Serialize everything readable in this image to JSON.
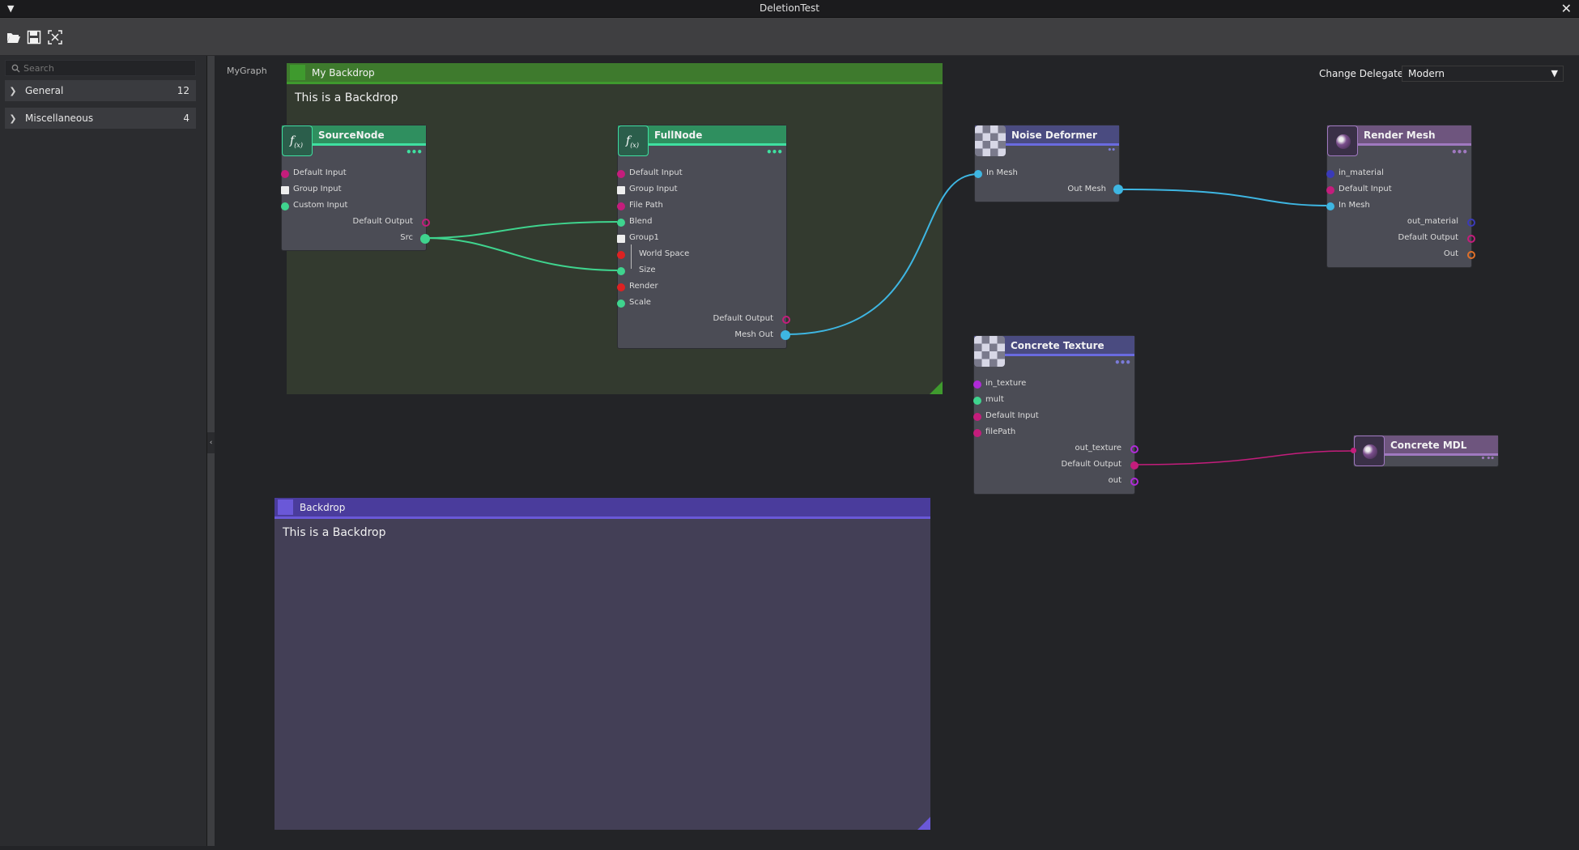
{
  "window": {
    "title": "DeletionTest"
  },
  "sidebar": {
    "search_placeholder": "Search",
    "categories": [
      {
        "label": "General",
        "count": "12"
      },
      {
        "label": "Miscellaneous",
        "count": "4"
      }
    ]
  },
  "canvas": {
    "graph_name": "MyGraph",
    "delegate_label": "Change Delegate",
    "delegate_value": "Modern"
  },
  "backdrops": {
    "green": {
      "title": "My Backdrop",
      "text": "This is a Backdrop",
      "color": "#3f9a2e"
    },
    "purple": {
      "title": "Backdrop",
      "text": "This is a Backdrop",
      "color": "#5849b8"
    }
  },
  "nodes": {
    "source": {
      "title": "SourceNode",
      "inputs": [
        "Default Input",
        "Group Input",
        "Custom Input"
      ],
      "outputs": [
        "Default Output",
        "Src"
      ]
    },
    "full": {
      "title": "FullNode",
      "inputs": [
        "Default Input",
        "Group Input",
        "File Path",
        "Blend",
        "Group1",
        "World Space",
        "Size",
        "Render",
        "Scale"
      ],
      "outputs": [
        "Default Output",
        "Mesh Out"
      ]
    },
    "noise": {
      "title": "Noise Deformer",
      "inputs": [
        "In Mesh"
      ],
      "outputs": [
        "Out Mesh"
      ]
    },
    "render": {
      "title": "Render Mesh",
      "inputs": [
        "in_material",
        "Default Input",
        "In Mesh"
      ],
      "outputs": [
        "out_material",
        "Default Output",
        "Out"
      ]
    },
    "texture": {
      "title": "Concrete Texture",
      "inputs": [
        "in_texture",
        "mult",
        "Default Input",
        "filePath"
      ],
      "outputs": [
        "out_texture",
        "Default Output",
        "out"
      ]
    },
    "mdl": {
      "title": "Concrete MDL"
    }
  },
  "colors": {
    "green_node": "#2f8f5f",
    "green_accent": "#3fe0a0",
    "noise_node": "#4a4b80",
    "render_node": "#6e557e",
    "wire_green": "#3fd48e",
    "wire_blue": "#3eb6e2",
    "wire_magenta": "#c41d7c"
  },
  "icons": [
    "menu-arrow-icon",
    "close-icon",
    "open-folder-icon",
    "save-icon",
    "fit-view-icon",
    "search-icon",
    "chevron-right-icon",
    "function-icon",
    "checker-texture-icon",
    "sphere-material-icon"
  ]
}
